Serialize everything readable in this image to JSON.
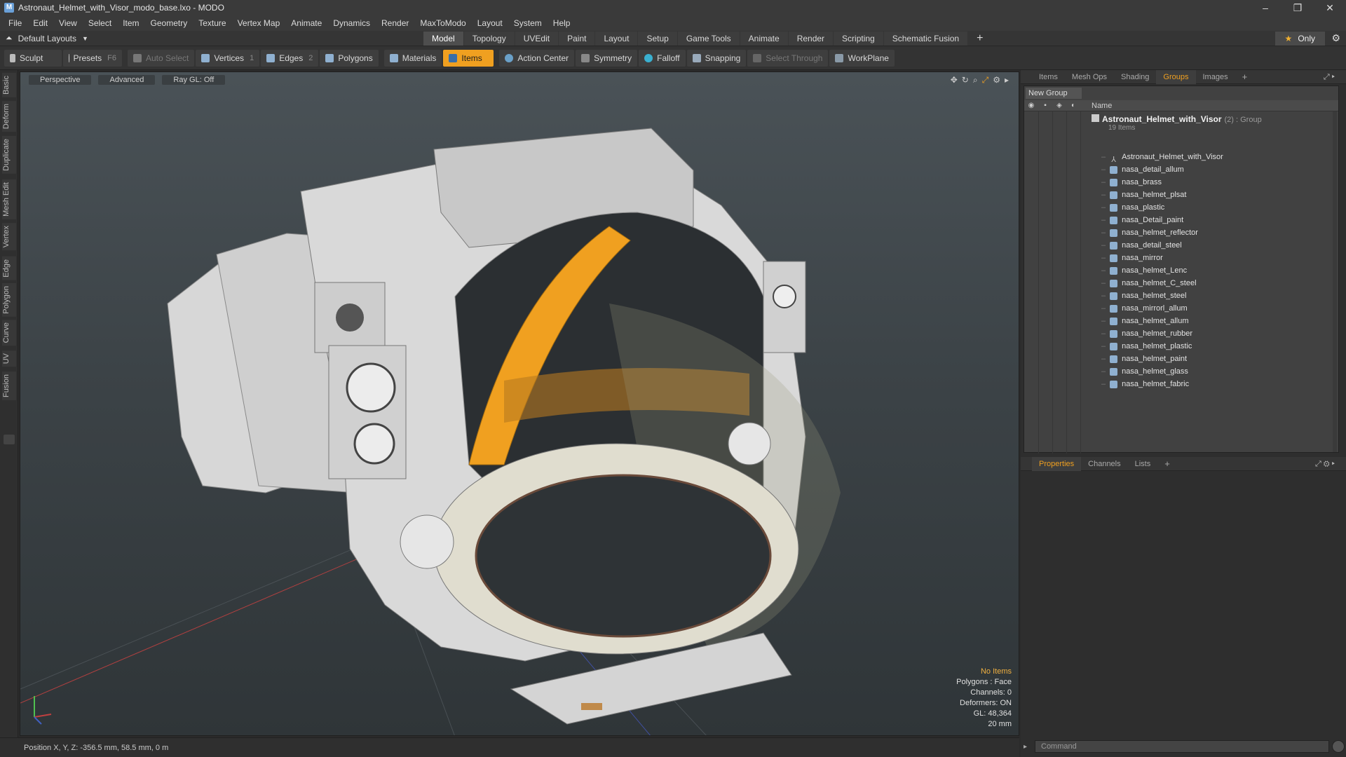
{
  "window": {
    "title": "Astronaut_Helmet_with_Visor_modo_base.lxo - MODO",
    "app_icon": "modo-icon"
  },
  "menu": [
    "File",
    "Edit",
    "View",
    "Select",
    "Item",
    "Geometry",
    "Texture",
    "Vertex Map",
    "Animate",
    "Dynamics",
    "Render",
    "MaxToModo",
    "Layout",
    "System",
    "Help"
  ],
  "layoutbar": {
    "layout_selector": "Default Layouts",
    "tabs": [
      "Model",
      "Topology",
      "UVEdit",
      "Paint",
      "Layout",
      "Setup",
      "Game Tools",
      "Animate",
      "Render",
      "Scripting",
      "Schematic Fusion"
    ],
    "active_tab": "Model",
    "only_label": "Only"
  },
  "toolbar": {
    "sculpt": "Sculpt",
    "presets": "Presets",
    "presets_key": "F6",
    "auto_select": "Auto Select",
    "vertices": "Vertices",
    "vertices_key": "1",
    "edges": "Edges",
    "edges_key": "2",
    "polygons": "Polygons",
    "materials": "Materials",
    "items": "Items",
    "action_center": "Action Center",
    "symmetry": "Symmetry",
    "falloff": "Falloff",
    "snapping": "Snapping",
    "select_through": "Select Through",
    "workplane": "WorkPlane"
  },
  "left_tabs": [
    "Basic",
    "Deform",
    "Duplicate",
    "Mesh Edit",
    "Vertex",
    "Edge",
    "Polygon",
    "Curve",
    "UV",
    "Fusion"
  ],
  "viewport": {
    "view_mode": "Perspective",
    "shading": "Advanced",
    "raygl": "Ray GL: Off",
    "info": {
      "selection": "No Items",
      "polygons": "Polygons : Face",
      "channels": "Channels: 0",
      "deformers": "Deformers: ON",
      "gl": "GL: 48,364",
      "scale": "20 mm"
    }
  },
  "statusbar": {
    "position": "Position X, Y, Z:  -356.5 mm, 58.5 mm, 0 m"
  },
  "panel_top": {
    "tabs": [
      "Items",
      "Mesh Ops",
      "Shading",
      "Groups",
      "Images"
    ],
    "active_tab": "Groups",
    "new_group": "New Group",
    "col_name": "Name",
    "root": {
      "name": "Astronaut_Helmet_with_Visor",
      "count": "(2) : Group",
      "sub": "19 Items"
    },
    "items": [
      "Astronaut_Helmet_with_Visor",
      "nasa_detail_allum",
      "nasa_brass",
      "nasa_helmet_plsat",
      "nasa_plastic",
      "nasa_Detail_paint",
      "nasa_helmet_reflector",
      "nasa_detail_steel",
      "nasa_mirror",
      "nasa_helmet_Lenc",
      "nasa_helmet_C_steel",
      "nasa_helmet_steel",
      "nasa_mirrorl_allum",
      "nasa_helmet_allum",
      "nasa_helmet_rubber",
      "nasa_helmet_plastic",
      "nasa_helmet_paint",
      "nasa_helmet_glass",
      "nasa_helmet_fabric"
    ]
  },
  "panel_bottom": {
    "tabs": [
      "Properties",
      "Channels",
      "Lists"
    ],
    "active_tab": "Properties"
  },
  "command": {
    "placeholder": "Command"
  },
  "colors": {
    "accent": "#f0a020",
    "viewport_bg": "#3c4347",
    "helmet": "#cfcfcf",
    "visor_gold": "#f0a020"
  }
}
